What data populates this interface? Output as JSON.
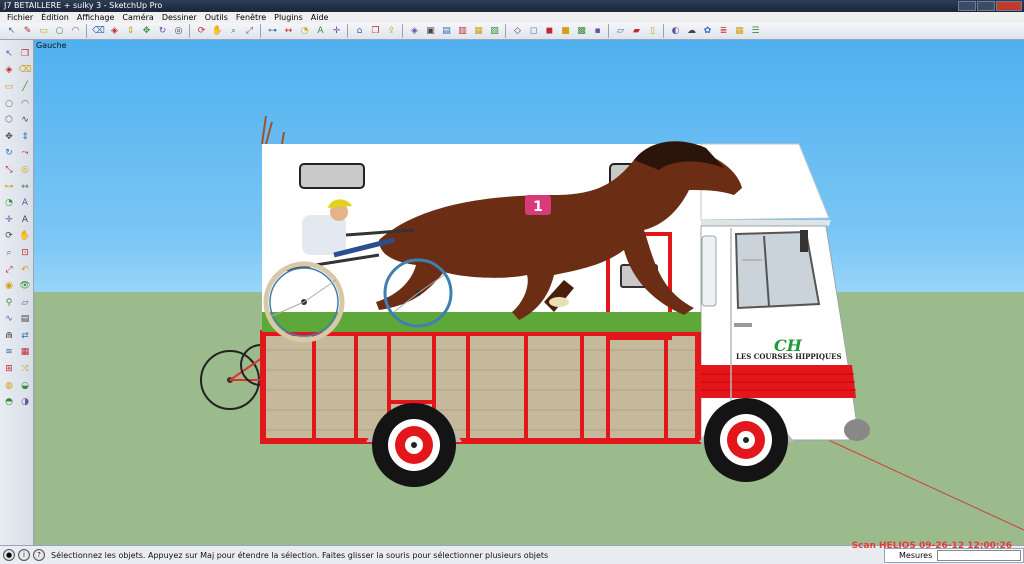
{
  "window": {
    "title": "J7 BETAILLERE + sulky 3 - SketchUp Pro"
  },
  "menu": [
    "Fichier",
    "Édition",
    "Affichage",
    "Caméra",
    "Dessiner",
    "Outils",
    "Fenêtre",
    "Plugins",
    "Aide"
  ],
  "toolbar_top": [
    "select-icon",
    "pencil-icon",
    "rectangle-icon",
    "circle-icon",
    "arc-icon",
    "sep",
    "eraser-icon",
    "paint-icon",
    "push-pull-icon",
    "move-icon",
    "rotate-icon",
    "offset-icon",
    "sep",
    "orbit-icon",
    "pan-icon",
    "zoom-icon",
    "zoom-extents-icon",
    "sep",
    "tape-icon",
    "dimension-icon",
    "protractor-icon",
    "text-icon",
    "axes-icon",
    "sep",
    "warehouse-icon",
    "component-icon",
    "share-icon",
    "sep",
    "iso-view-icon",
    "top-view-icon",
    "front-view-icon",
    "right-view-icon",
    "back-view-icon",
    "left-view-icon",
    "sep",
    "xray-icon",
    "wireframe-icon",
    "hidden-line-icon",
    "shaded-icon",
    "textured-icon",
    "monochrome-icon",
    "sep",
    "section-plane-icon",
    "section-display-icon",
    "section-cut-icon",
    "sep",
    "shadow-icon",
    "fog-icon",
    "style-icon",
    "layer-icon",
    "scene-icon",
    "outliner-icon"
  ],
  "toolbar_left": [
    [
      "select-icon",
      "component-icon"
    ],
    [
      "paint-icon",
      "eraser-icon"
    ],
    [
      "rectangle-icon",
      "line-icon"
    ],
    [
      "circle-icon",
      "arc-icon"
    ],
    [
      "polygon-icon",
      "freehand-icon"
    ],
    [
      "move-icon",
      "push-pull-icon"
    ],
    [
      "rotate-icon",
      "follow-me-icon"
    ],
    [
      "scale-icon",
      "offset-icon"
    ],
    [
      "tape-icon",
      "dimension-icon"
    ],
    [
      "protractor-icon",
      "text-icon"
    ],
    [
      "axes-icon",
      "3d-text-icon"
    ],
    [
      "orbit-icon",
      "pan-icon"
    ],
    [
      "zoom-icon",
      "zoom-window-icon"
    ],
    [
      "zoom-extents-icon",
      "previous-icon"
    ],
    [
      "position-camera-icon",
      "look-around-icon"
    ],
    [
      "walk-icon",
      "section-icon"
    ],
    [
      "sandbox-smoove-icon",
      "sandbox-stamp-icon"
    ],
    [
      "sandbox-drape-icon",
      "sandbox-flip-icon"
    ],
    [
      "sandbox-from-contours-icon",
      "sandbox-grid-icon"
    ],
    [
      "sandbox-add-detail-icon",
      "sandbox-flip-edge-icon"
    ],
    [
      "solid-union-icon",
      "solid-subtract-icon"
    ],
    [
      "solid-trim-icon",
      "solid-intersect-icon"
    ]
  ],
  "viewport": {
    "view_label": "Gauche"
  },
  "truck": {
    "banner_logo": "CH",
    "banner_text": "LES COURSES HIPPIQUES",
    "race_number": "1"
  },
  "status": {
    "message": "Sélectionnez les objets. Appuyez sur Maj pour étendre la sélection. Faites glisser la souris pour sélectionner plusieurs objets",
    "measures_label": "Mesures",
    "watermark": "Scan HELIOS 09-26-12 12:00:26"
  }
}
